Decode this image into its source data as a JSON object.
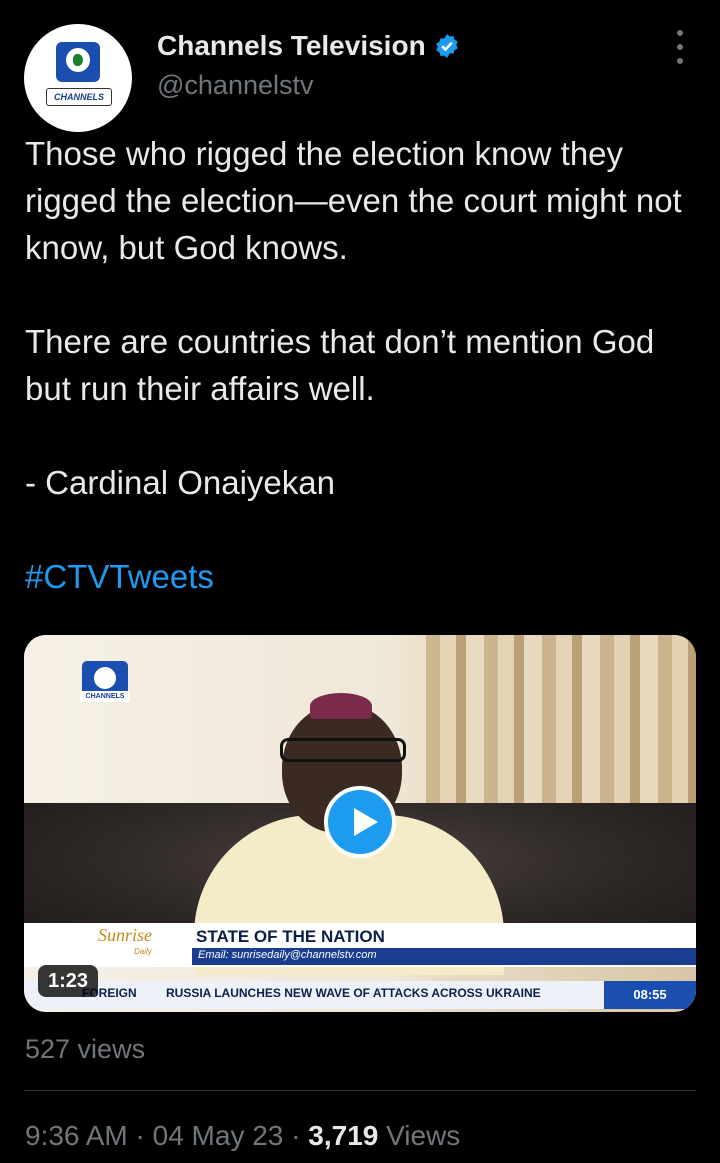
{
  "author": {
    "display_name": "Channels Television",
    "handle": "@channelstv",
    "avatar_brand": "CHANNELS",
    "verified_icon": "verified-badge-icon",
    "more_icon": "more-options-icon"
  },
  "tweet": {
    "text": "Those who rigged the election know they rigged the election—even the court might not know, but God knows.\n\nThere are countries that don’t mention God but run their affairs well.\n\n- Cardinal Onaiyekan\n\n",
    "hashtag": "#CTVTweets"
  },
  "video": {
    "channel_logo_text": "CHANNELS",
    "show_brand": "Sunrise",
    "show_brand_sub": "Daily",
    "lower_third_title": "STATE OF THE NATION",
    "lower_third_email": "Email: sunrisedaily@channelstv.com",
    "ticker_category": "FOREIGN",
    "ticker_headline": "RUSSIA LAUNCHES NEW WAVE OF ATTACKS ACROSS UKRAINE",
    "ticker_time": "08:55",
    "duration": "1:23",
    "play_icon": "play-icon",
    "views": "527 views"
  },
  "meta": {
    "time": "9:36 AM",
    "date": "04 May 23",
    "separator": " · ",
    "view_count": "3,719",
    "view_label": " Views"
  },
  "colors": {
    "background": "#000000",
    "text": "#e7e9ea",
    "secondary": "#71767b",
    "accent": "#1d9bf0"
  }
}
